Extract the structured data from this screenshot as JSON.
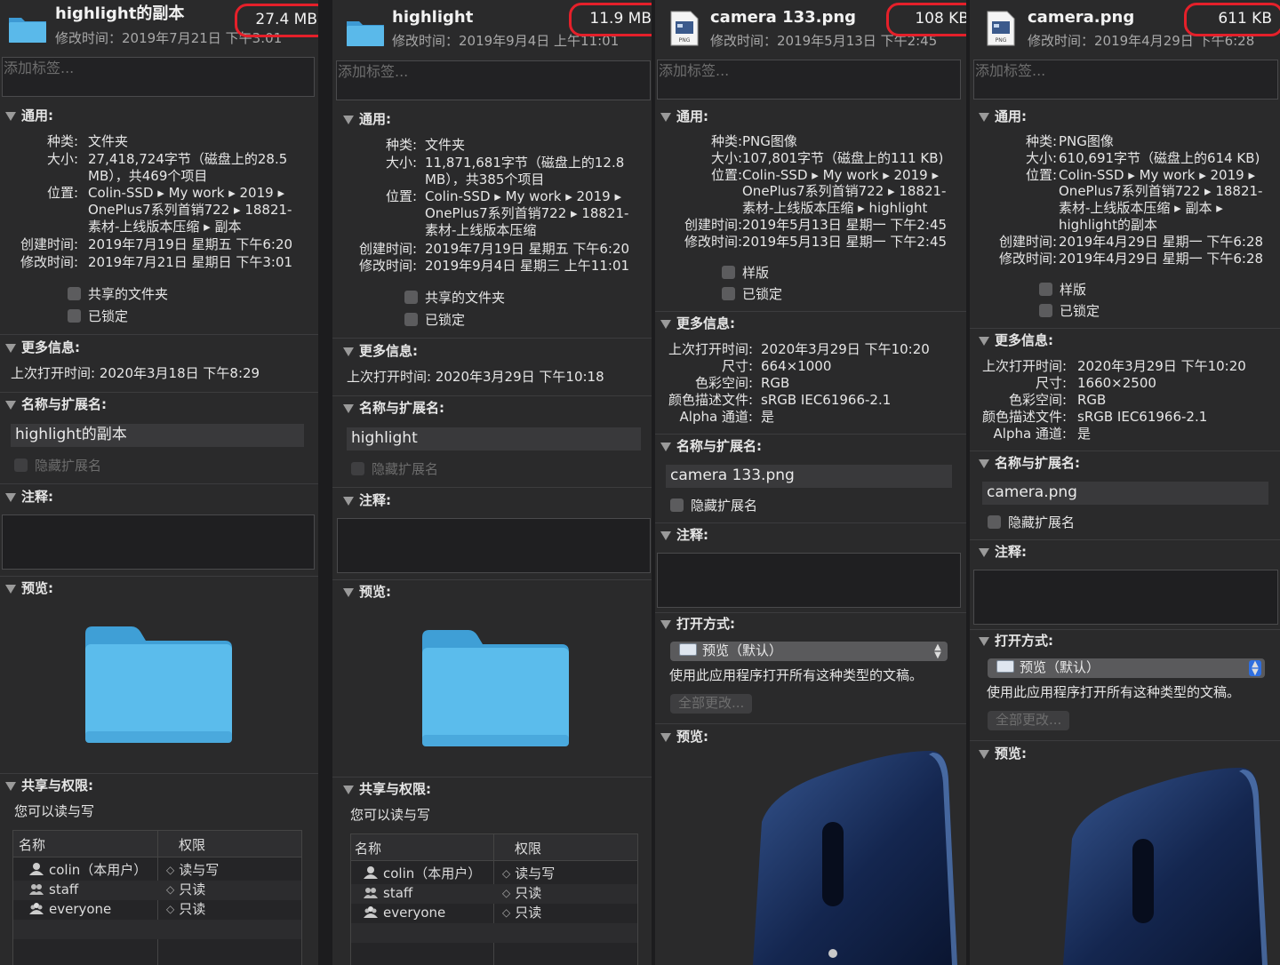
{
  "panes": [
    {
      "header": {
        "name": "highlight的副本",
        "modified": "修改时间：2019年7月21日 下午3:01",
        "size": "27.4 MB"
      },
      "tag_placeholder": "添加标签...",
      "general": {
        "title": "通用:",
        "kind_label": "种类:",
        "kind": "文件夹",
        "size_label": "大小:",
        "size_lines": [
          "27,418,724字节（磁盘上的28.5",
          "MB），共469个项目"
        ],
        "where_label": "位置:",
        "where_lines": [
          "Colin-SSD ▸ My work ▸ 2019 ▸",
          "OnePlus7系列首销722 ▸ 18821-",
          "素材-上线版本压缩 ▸ 副本"
        ],
        "created_label": "创建时间:",
        "created": "2019年7月19日 星期五 下午6:20",
        "modified_label": "修改时间:",
        "modified": "2019年7月21日 星期日 下午3:01",
        "check1": "共享的文件夹",
        "check2": "已锁定"
      },
      "more": {
        "title": "更多信息:",
        "last_opened_label": "上次打开时间:",
        "last_opened": "2020年3月18日 下午8:29"
      },
      "name_ext": {
        "title": "名称与扩展名:",
        "value": "highlight的副本",
        "hide_ext": "隐藏扩展名"
      },
      "comments": {
        "title": "注释:"
      },
      "preview": {
        "title": "预览:"
      },
      "sharing": {
        "title": "共享与权限:",
        "summary": "您可以读与写",
        "col_name": "名称",
        "col_priv": "权限",
        "rows": [
          {
            "name": "colin（本用户）",
            "priv": "读与写"
          },
          {
            "name": "staff",
            "priv": "只读"
          },
          {
            "name": "everyone",
            "priv": "只读"
          }
        ]
      }
    },
    {
      "header": {
        "name": "highlight",
        "modified": "修改时间：2019年9月4日 上午11:01",
        "size": "11.9 MB"
      },
      "tag_placeholder": "添加标签...",
      "general": {
        "title": "通用:",
        "kind_label": "种类:",
        "kind": "文件夹",
        "size_label": "大小:",
        "size_lines": [
          "11,871,681字节（磁盘上的12.8",
          "MB），共385个项目"
        ],
        "where_label": "位置:",
        "where_lines": [
          "Colin-SSD ▸ My work ▸ 2019 ▸",
          "OnePlus7系列首销722 ▸ 18821-",
          "素材-上线版本压缩"
        ],
        "created_label": "创建时间:",
        "created": "2019年7月19日 星期五 下午6:20",
        "modified_label": "修改时间:",
        "modified": "2019年9月4日 星期三 上午11:01",
        "check1": "共享的文件夹",
        "check2": "已锁定"
      },
      "more": {
        "title": "更多信息:",
        "last_opened_label": "上次打开时间:",
        "last_opened": "2020年3月29日 下午10:18"
      },
      "name_ext": {
        "title": "名称与扩展名:",
        "value": "highlight",
        "hide_ext": "隐藏扩展名"
      },
      "comments": {
        "title": "注释:"
      },
      "preview": {
        "title": "预览:"
      },
      "sharing": {
        "title": "共享与权限:",
        "summary": "您可以读与写",
        "col_name": "名称",
        "col_priv": "权限",
        "rows": [
          {
            "name": "colin（本用户）",
            "priv": "读与写"
          },
          {
            "name": "staff",
            "priv": "只读"
          },
          {
            "name": "everyone",
            "priv": "只读"
          }
        ]
      }
    },
    {
      "header": {
        "name": "camera 133.png",
        "modified": "修改时间：2019年5月13日 下午2:45",
        "size": "108 KB"
      },
      "tag_placeholder": "添加标签...",
      "general": {
        "title": "通用:",
        "kind_label": "种类:",
        "kind": "PNG图像",
        "size_label": "大小:",
        "size_lines": [
          "107,801字节（磁盘上的111 KB)"
        ],
        "where_label": "位置:",
        "where_lines": [
          "Colin-SSD ▸ My work ▸ 2019 ▸",
          "OnePlus7系列首销722 ▸ 18821-",
          "素材-上线版本压缩 ▸ highlight"
        ],
        "created_label": "创建时间:",
        "created": "2019年5月13日 星期一 下午2:45",
        "modified_label": "修改时间:",
        "modified": "2019年5月13日 星期一 下午2:45",
        "check1": "样版",
        "check2": "已锁定"
      },
      "more": {
        "title": "更多信息:",
        "last_opened_label": "上次打开时间:",
        "last_opened": "2020年3月29日 下午10:20",
        "dims_label": "尺寸:",
        "dims": "664×1000",
        "color_label": "色彩空间:",
        "color": "RGB",
        "profile_label": "颜色描述文件:",
        "profile": "sRGB IEC61966-2.1",
        "alpha_label": "Alpha 通道:",
        "alpha": "是"
      },
      "name_ext": {
        "title": "名称与扩展名:",
        "value": "camera 133.png",
        "hide_ext": "隐藏扩展名"
      },
      "comments": {
        "title": "注释:"
      },
      "open_with": {
        "title": "打开方式:",
        "app": "预览（默认）",
        "note": "使用此应用程序打开所有这种类型的文稿。",
        "change_all": "全部更改..."
      },
      "preview": {
        "title": "预览:"
      }
    },
    {
      "header": {
        "name": "camera.png",
        "modified": "修改时间：2019年4月29日 下午6:28",
        "size": "611 KB"
      },
      "tag_placeholder": "添加标签...",
      "general": {
        "title": "通用:",
        "kind_label": "种类:",
        "kind": "PNG图像",
        "size_label": "大小:",
        "size_lines": [
          "610,691字节（磁盘上的614 KB)"
        ],
        "where_label": "位置:",
        "where_lines": [
          "Colin-SSD ▸ My work ▸ 2019 ▸",
          "OnePlus7系列首销722 ▸ 18821-",
          "素材-上线版本压缩 ▸ 副本 ▸",
          "highlight的副本"
        ],
        "created_label": "创建时间:",
        "created": "2019年4月29日 星期一 下午6:28",
        "modified_label": "修改时间:",
        "modified": "2019年4月29日 星期一 下午6:28",
        "check1": "样版",
        "check2": "已锁定"
      },
      "more": {
        "title": "更多信息:",
        "last_opened_label": "上次打开时间:",
        "last_opened": "2020年3月29日 下午10:20",
        "dims_label": "尺寸:",
        "dims": "1660×2500",
        "color_label": "色彩空间:",
        "color": "RGB",
        "profile_label": "颜色描述文件:",
        "profile": "sRGB IEC61966-2.1",
        "alpha_label": "Alpha 通道:",
        "alpha": "是"
      },
      "name_ext": {
        "title": "名称与扩展名:",
        "value": "camera.png",
        "hide_ext": "隐藏扩展名"
      },
      "comments": {
        "title": "注释:"
      },
      "open_with": {
        "title": "打开方式:",
        "app": "预览（默认）",
        "note": "使用此应用程序打开所有这种类型的文稿。",
        "change_all": "全部更改..."
      },
      "preview": {
        "title": "预览:"
      }
    }
  ],
  "icons": {
    "folder": "folder-icon",
    "png": "png-file-icon",
    "user": "user-icon",
    "group": "group-icon",
    "everyone": "everyone-icon"
  },
  "colors": {
    "highlight_ring": "#e5202a",
    "folder_blue": "#4fb2e6",
    "panel_bg": "#2a2a2b"
  }
}
